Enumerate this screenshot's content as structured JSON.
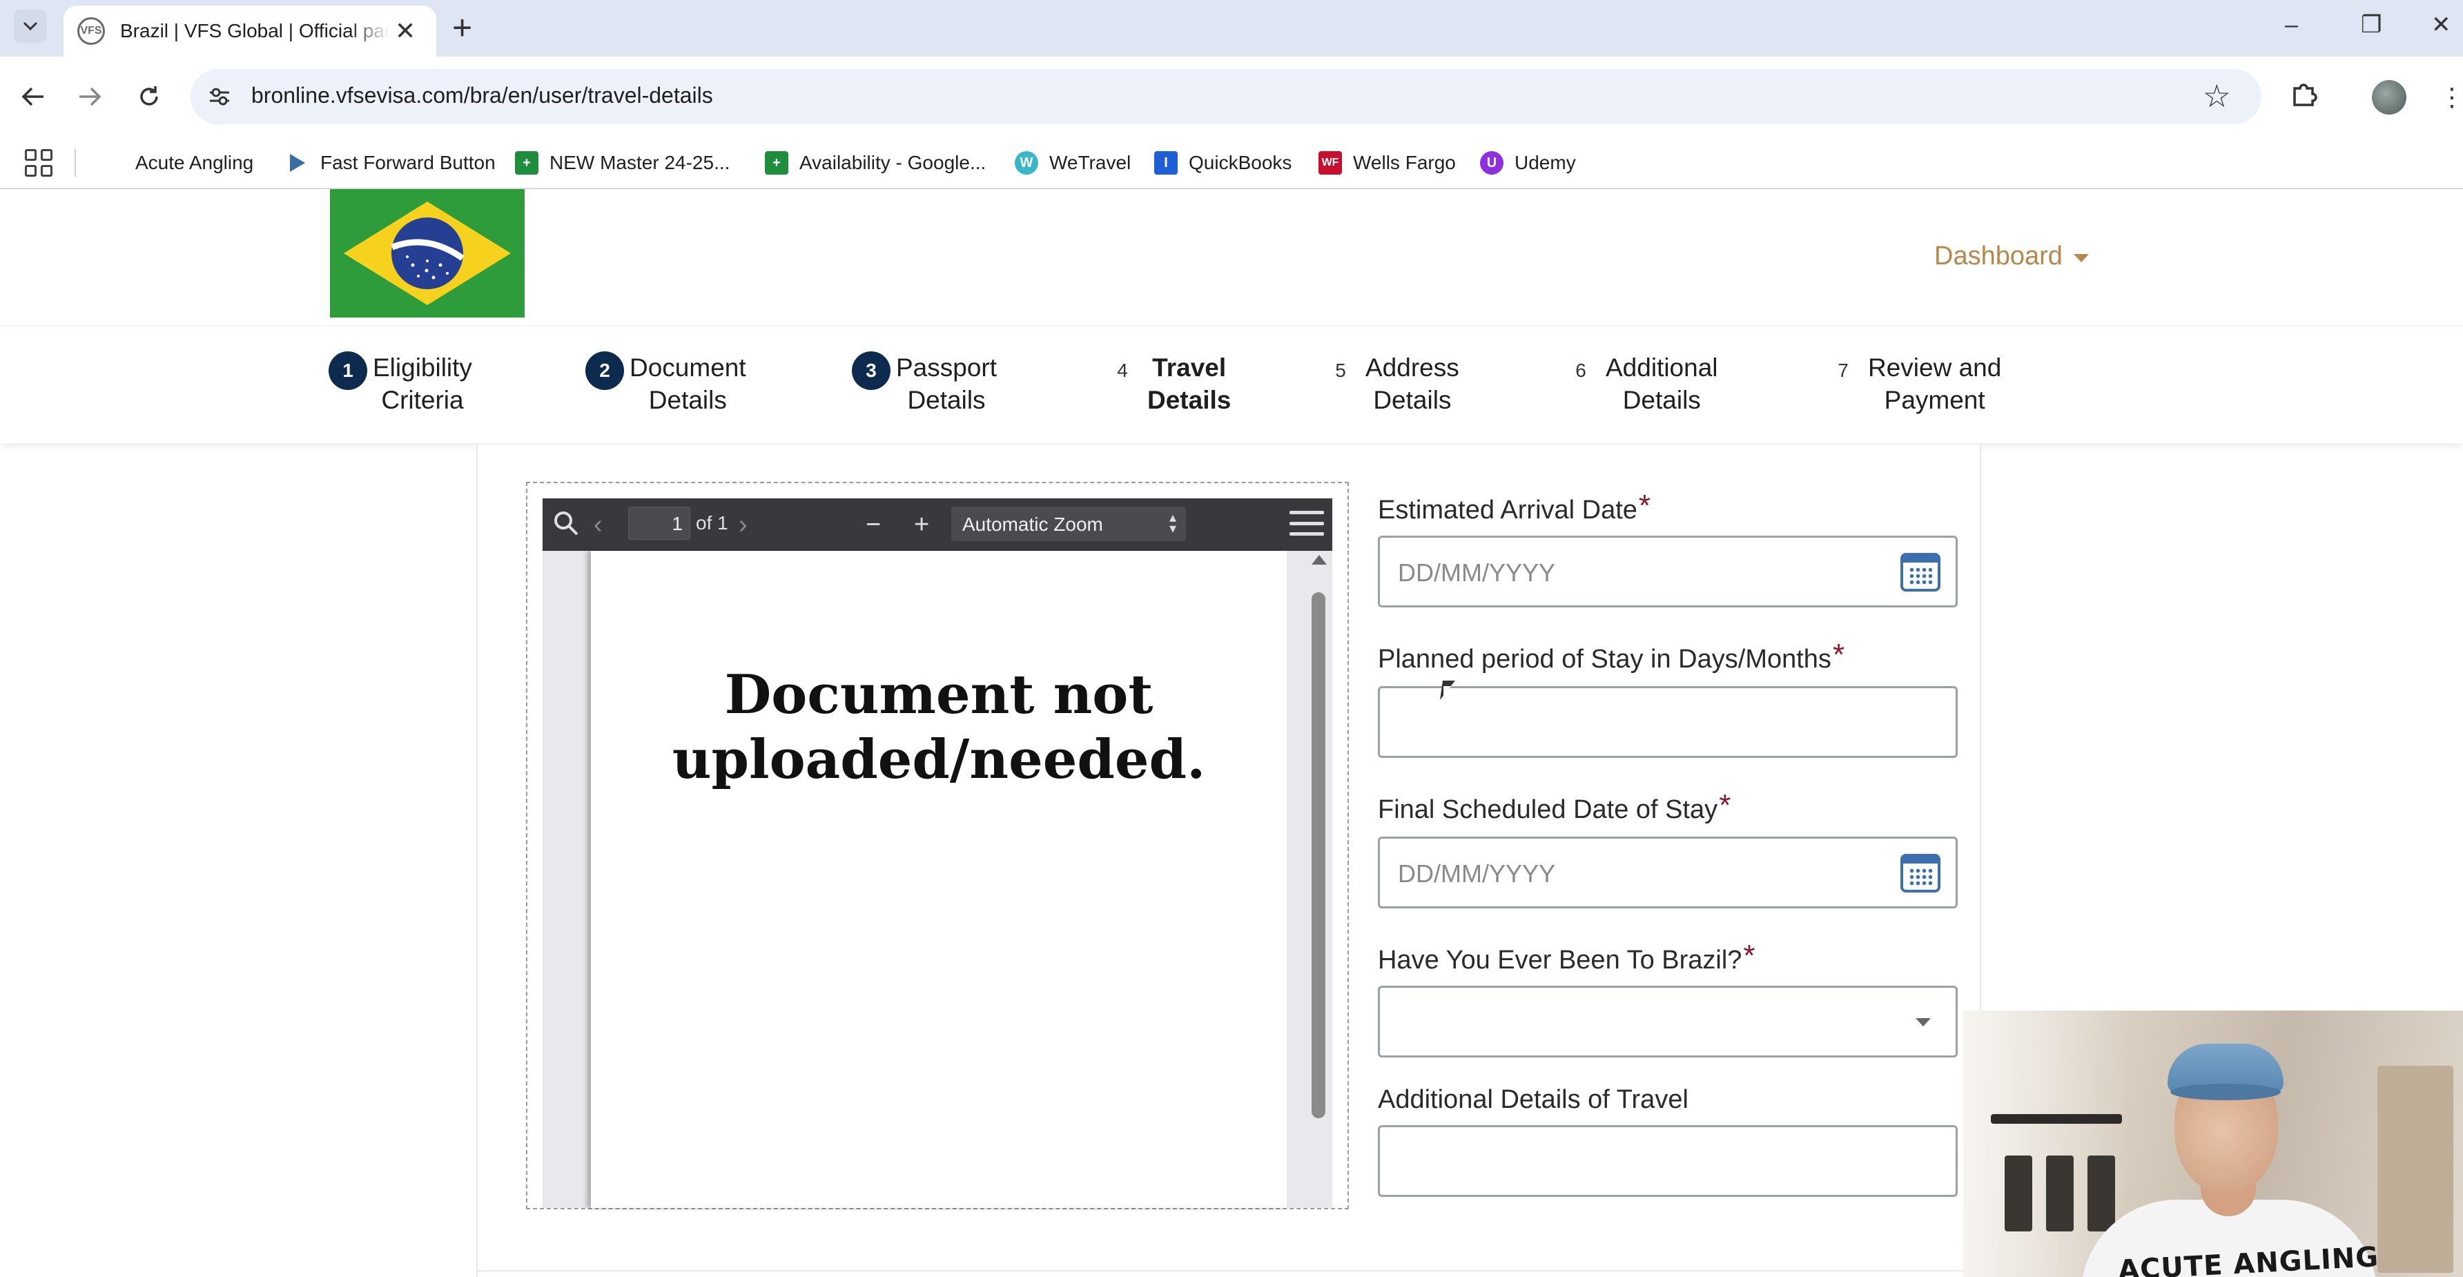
{
  "browser": {
    "tab_title": "Brazil | VFS Global | Official part",
    "tab_favicon_text": "VFS",
    "new_tab": "+",
    "url": "bronline.vfsevisa.com/bra/en/user/travel-details"
  },
  "bookmarks": [
    {
      "label": "Acute Angling",
      "icon": "none",
      "color": ""
    },
    {
      "label": "Fast Forward Button",
      "icon": "play-triangle-icon",
      "color": "#3a6ea5"
    },
    {
      "label": "NEW Master 24-25...",
      "icon": "sheets-plus-icon",
      "color": "#1e8e3e"
    },
    {
      "label": "Availability - Google...",
      "icon": "sheets-plus-icon",
      "color": "#1e8e3e"
    },
    {
      "label": "WeTravel",
      "icon": "wetravel-icon",
      "color": "#39b6c8"
    },
    {
      "label": "QuickBooks",
      "icon": "quickbooks-icon",
      "color": "#1f5fd6"
    },
    {
      "label": "Wells Fargo",
      "icon": "wells-fargo-icon",
      "color": "#c8102e"
    },
    {
      "label": "Udemy",
      "icon": "udemy-icon",
      "color": "#8f2fe0"
    }
  ],
  "header": {
    "dashboard_label": "Dashboard"
  },
  "steps": [
    {
      "number": "1",
      "line1": "Eligibility",
      "line2": "Criteria",
      "state": "done"
    },
    {
      "number": "2",
      "line1": "Document",
      "line2": "Details",
      "state": "done"
    },
    {
      "number": "3",
      "line1": "Passport",
      "line2": "Details",
      "state": "done"
    },
    {
      "number": "4",
      "line1": "Travel",
      "line2": "Details",
      "state": "active"
    },
    {
      "number": "5",
      "line1": "Address",
      "line2": "Details",
      "state": "todo"
    },
    {
      "number": "6",
      "line1": "Additional",
      "line2": "Details",
      "state": "todo"
    },
    {
      "number": "7",
      "line1": "Review and",
      "line2": "Payment",
      "state": "todo"
    }
  ],
  "pdf_viewer": {
    "page_number": "1",
    "page_of": "of 1",
    "zoom": "Automatic Zoom",
    "message_line1": "Document not",
    "message_line2": "uploaded/needed."
  },
  "form": {
    "required_mark": "*",
    "arrival_label": "Estimated Arrival Date",
    "arrival_placeholder": "DD/MM/YYYY",
    "stay_label": "Planned period of Stay in Days/Months",
    "stay_value": "",
    "final_label": "Final Scheduled Date of Stay",
    "final_placeholder": "DD/MM/YYYY",
    "brazil_label": "Have You Ever Been To Brazil?",
    "brazil_value": "",
    "additional_label": "Additional Details of Travel",
    "additional_value": ""
  },
  "webcam": {
    "shirt_text": "ACUTE ANGLING"
  },
  "colors": {
    "step_done": "#0d2a4f",
    "dashboard": "#b8874a",
    "required": "#8b1a2b",
    "calendar": "#3b6fb0",
    "flag_green": "#2e9c3b",
    "flag_yellow": "#f6d21f",
    "flag_blue": "#253f92"
  }
}
